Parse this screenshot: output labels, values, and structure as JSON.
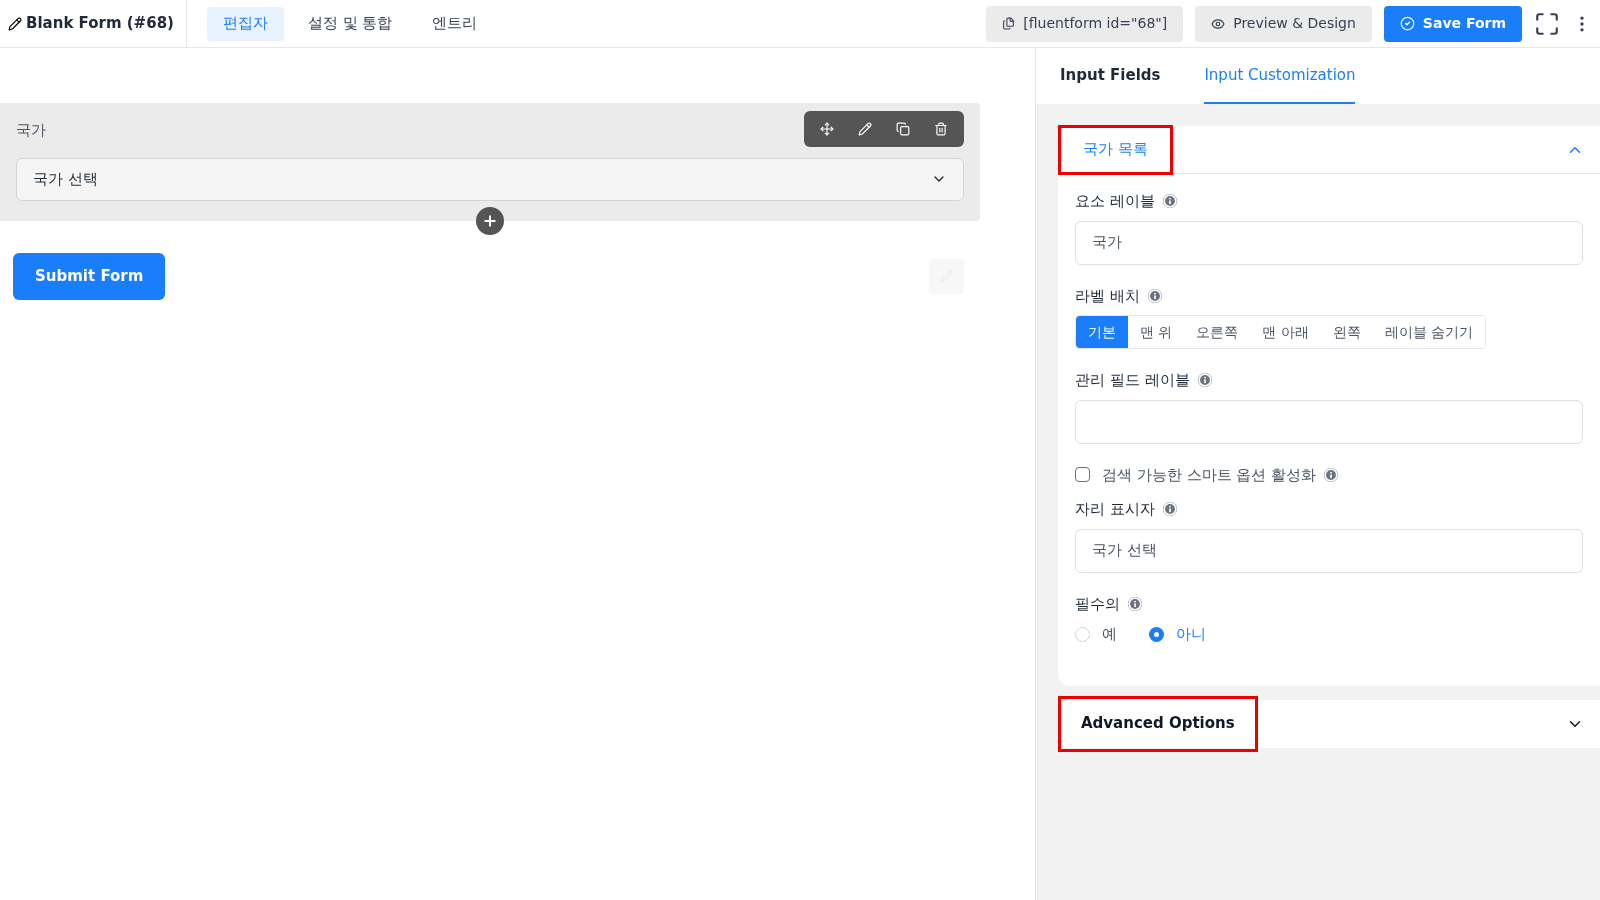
{
  "header": {
    "title": "Blank Form (#68)",
    "tabs": [
      {
        "label": "편집자",
        "selected": true
      },
      {
        "label": "설정 및 통합",
        "selected": false
      },
      {
        "label": "엔트리",
        "selected": false
      }
    ],
    "shortcode": "[fluentform id=\"68\"]",
    "preview": "Preview & Design",
    "save": "Save Form"
  },
  "canvas": {
    "field": {
      "label": "국가",
      "value": "국가 선택"
    },
    "submit": "Submit Form"
  },
  "panel": {
    "tabs": [
      {
        "label": "Input Fields",
        "selected": false
      },
      {
        "label": "Input Customization",
        "selected": true
      }
    ],
    "section": {
      "title": "국가 목록",
      "expanded": true,
      "highlighted": true,
      "settings": [
        {
          "kind": "text",
          "label": "요소 레이블",
          "value": "국가"
        },
        {
          "kind": "segmented",
          "label": "라벨 배치",
          "options": [
            {
              "label": "기본",
              "selected": true
            },
            {
              "label": "맨 위",
              "selected": false
            },
            {
              "label": "오른쪽",
              "selected": false
            },
            {
              "label": "맨 아래",
              "selected": false
            },
            {
              "label": "왼쪽",
              "selected": false
            },
            {
              "label": "레이블 숨기기",
              "selected": false
            }
          ]
        },
        {
          "kind": "text",
          "label": "관리 필드 레이블"
        },
        {
          "kind": "checkbox",
          "label": "검색 가능한 스마트 옵션 활성화",
          "checked": false
        },
        {
          "kind": "text",
          "label": "자리 표시자",
          "value": "국가 선택"
        },
        {
          "kind": "radio",
          "label": "필수의",
          "options": [
            {
              "label": "예",
              "selected": false
            },
            {
              "label": "아니",
              "selected": true
            }
          ]
        }
      ]
    },
    "advanced": {
      "title": "Advanced Options",
      "expanded": false,
      "highlighted": true
    }
  }
}
